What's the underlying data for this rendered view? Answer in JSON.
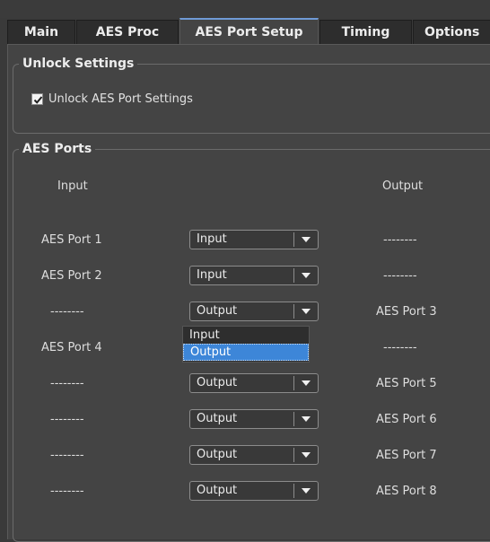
{
  "tabs": [
    {
      "label": "Main",
      "active": false
    },
    {
      "label": "AES Proc",
      "active": false
    },
    {
      "label": "AES Port Setup",
      "active": true
    },
    {
      "label": "Timing",
      "active": false
    },
    {
      "label": "Options",
      "active": false
    }
  ],
  "unlock_group": {
    "title": "Unlock Settings",
    "checkbox_label": "Unlock AES Port Settings",
    "checked": true
  },
  "ports_group": {
    "title": "AES Ports",
    "input_header": "Input",
    "output_header": "Output",
    "rows": [
      {
        "input": "AES Port 1",
        "mode": "Input",
        "output": "--------"
      },
      {
        "input": "AES Port 2",
        "mode": "Input",
        "output": "--------"
      },
      {
        "input": "--------",
        "mode": "Output",
        "output": "AES Port 3"
      },
      {
        "input": "AES Port 4",
        "mode": "Output",
        "output": "--------"
      },
      {
        "input": "--------",
        "mode": "Output",
        "output": "AES Port 5"
      },
      {
        "input": "--------",
        "mode": "Output",
        "output": "AES Port 6"
      },
      {
        "input": "--------",
        "mode": "Output",
        "output": "AES Port 7"
      },
      {
        "input": "--------",
        "mode": "Output",
        "output": "AES Port 8"
      }
    ]
  },
  "open_dropdown": {
    "options": [
      "Input",
      "Output"
    ],
    "selected": "Output"
  },
  "colors": {
    "background": "#444444",
    "tab_active_accent": "#6f9ad6",
    "selection": "#3d86d8"
  }
}
